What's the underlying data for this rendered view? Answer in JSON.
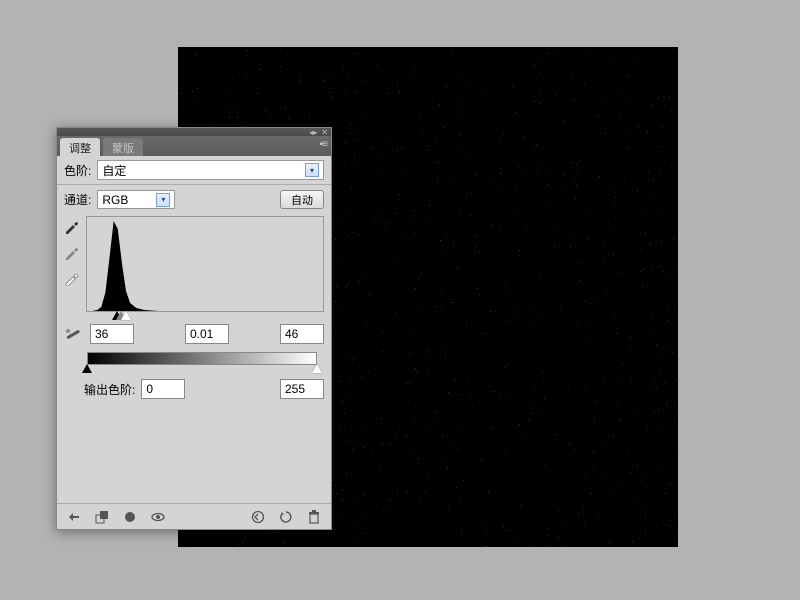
{
  "canvas": {
    "bg": "#000000",
    "noise_colors": [
      "#5a2a2a",
      "#2a5a2a",
      "#2a2a5a",
      "#555",
      "#664433",
      "#335544",
      "#334466"
    ]
  },
  "panel": {
    "tabs": {
      "active": "调整",
      "inactive": "蒙版"
    },
    "preset": {
      "label": "色阶:",
      "value": "自定"
    },
    "channel": {
      "label": "通道:",
      "value": "RGB",
      "auto_button": "自动"
    },
    "input_levels": {
      "black": "36",
      "gamma": "0.01",
      "white": "46"
    },
    "output": {
      "label": "输出色阶:",
      "black": "0",
      "white": "255"
    }
  },
  "icons": {
    "eyedropper_black": "eyedropper-black-icon",
    "eyedropper_gray": "eyedropper-gray-icon",
    "eyedropper_white": "eyedropper-white-icon",
    "magic": "magic-wand-icon"
  }
}
